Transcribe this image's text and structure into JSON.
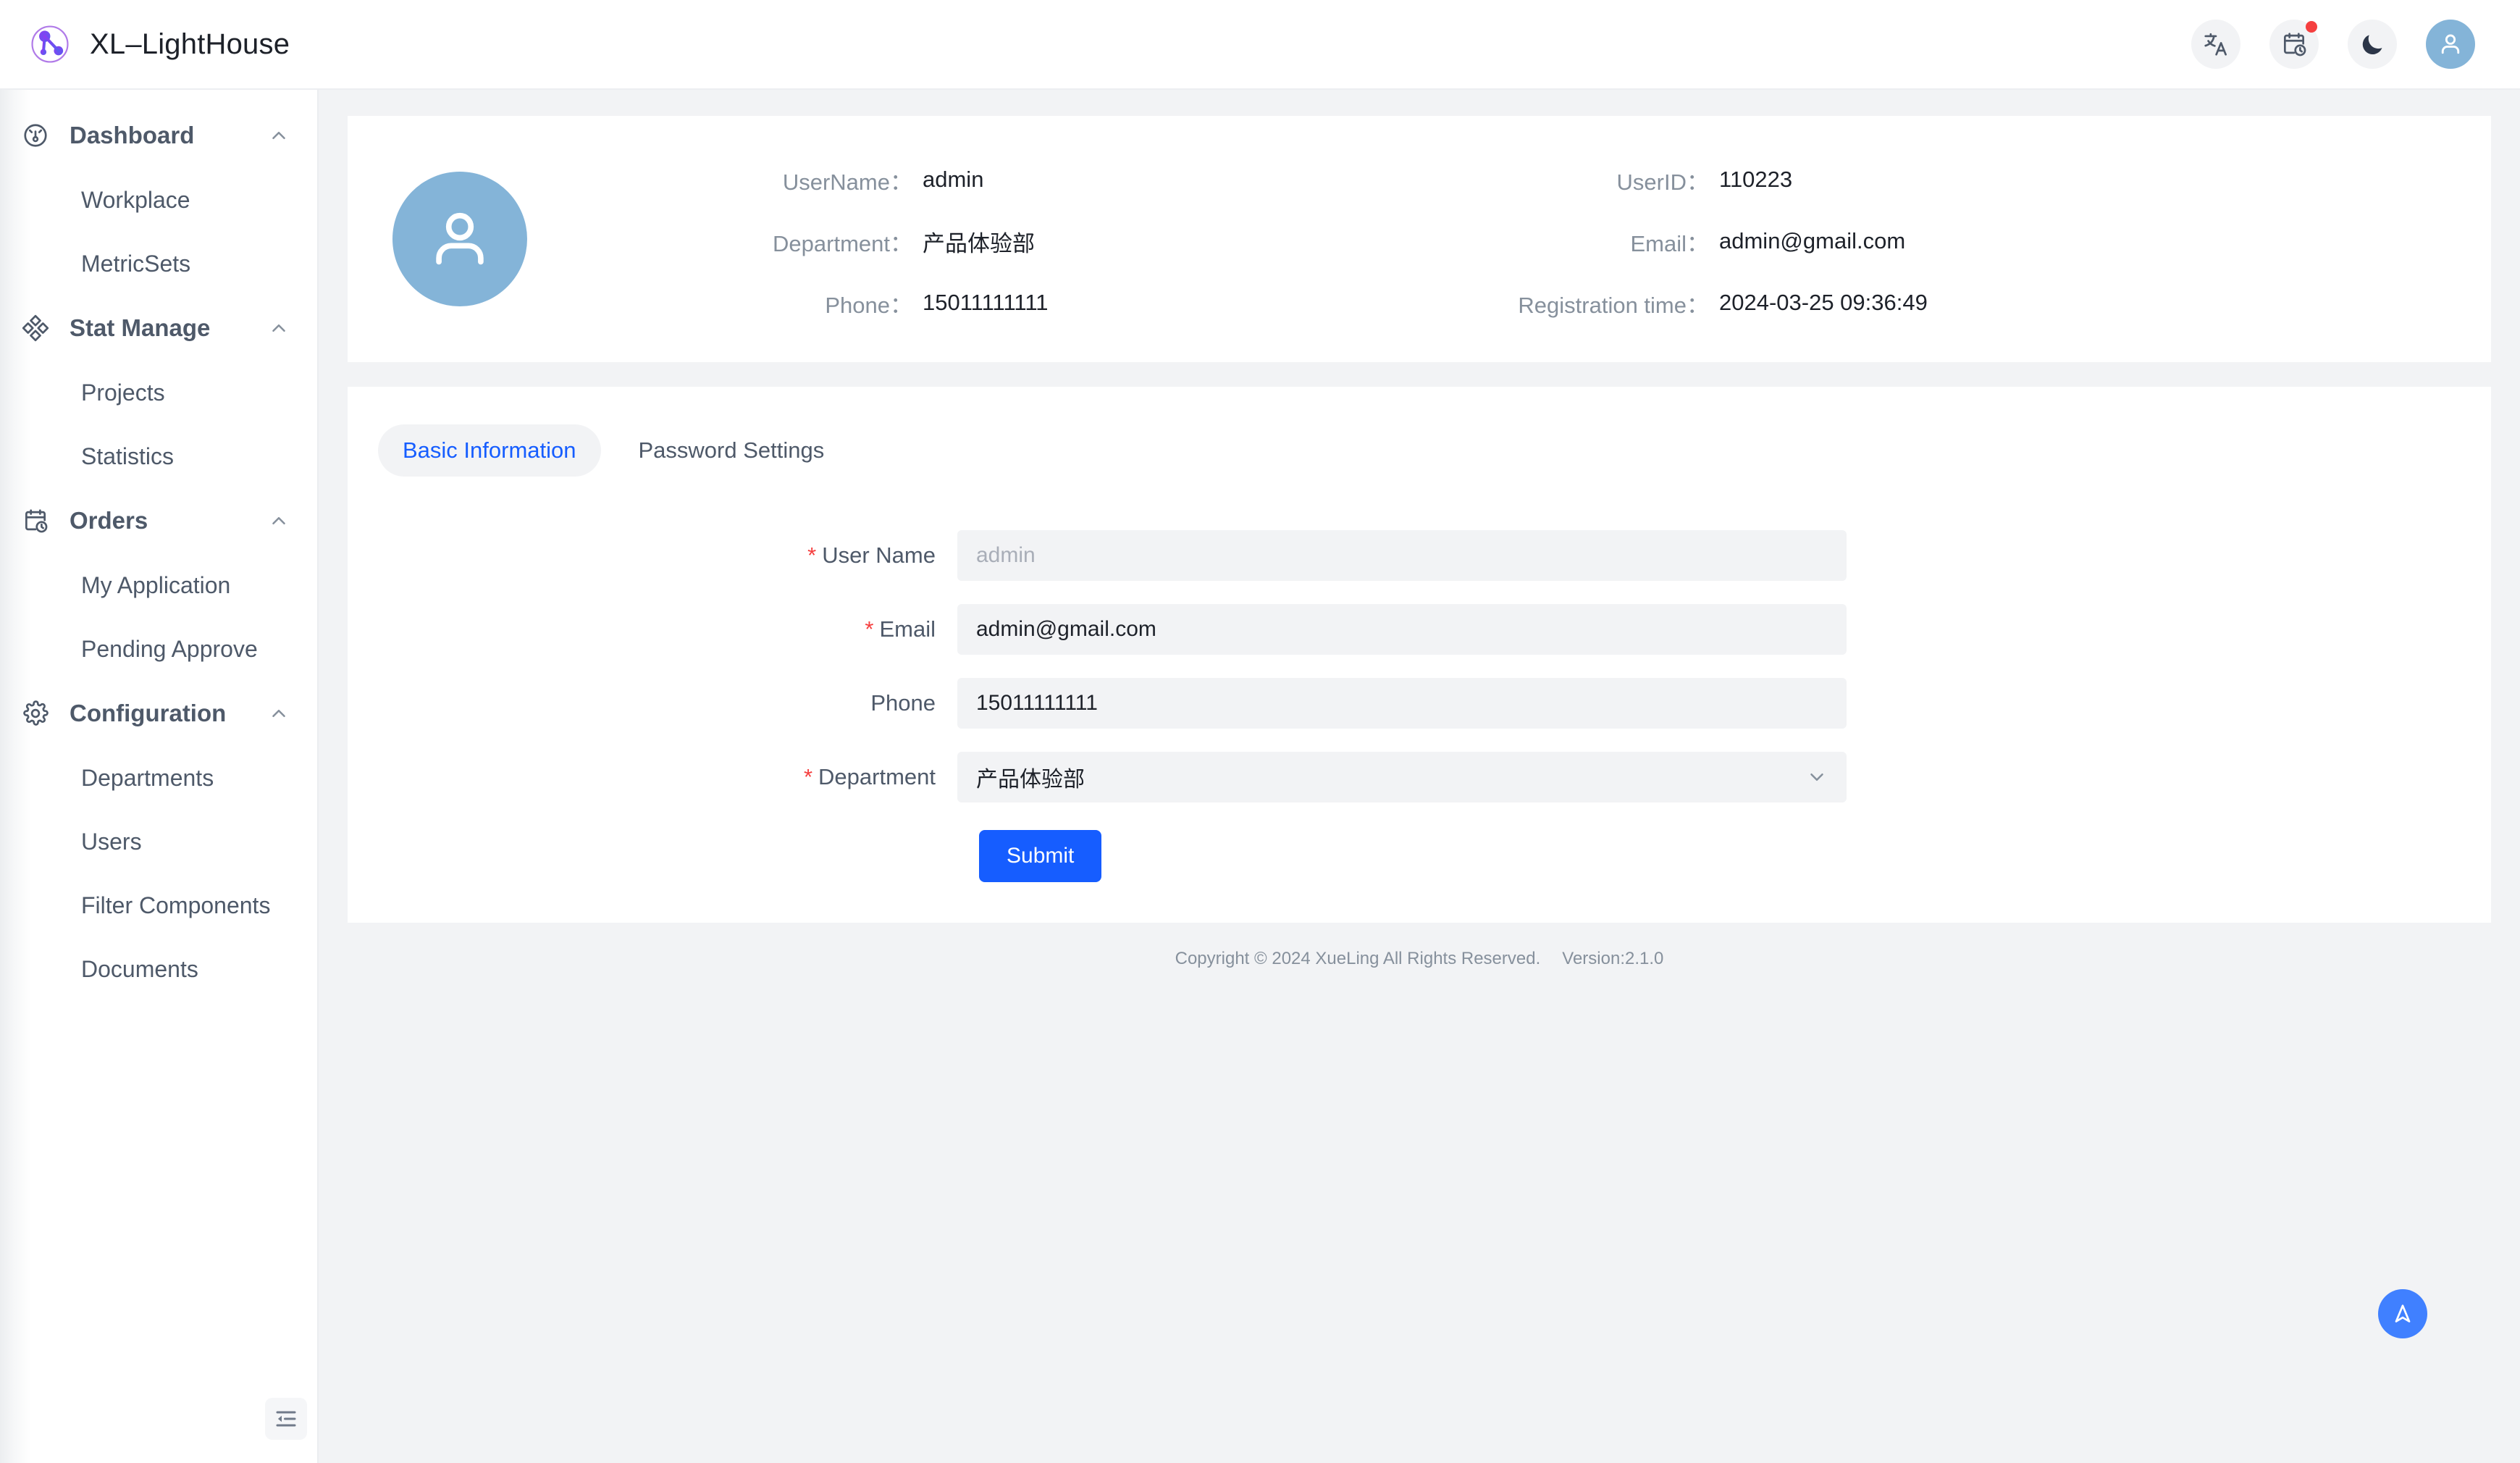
{
  "app": {
    "brand_name": "XL–LightHouse",
    "logo_icon": "molecule-logo-icon",
    "accent_color": "#165dff",
    "avatar_color": "#84b4d8",
    "badge_color": "#f53f3f"
  },
  "header": {
    "actions": [
      {
        "name": "translate",
        "icon": "translate-icon",
        "badge": false
      },
      {
        "name": "schedule",
        "icon": "calendar-clock-icon",
        "badge": true
      },
      {
        "name": "dark-mode",
        "icon": "moon-icon",
        "badge": false
      }
    ],
    "avatar_icon": "user-avatar-icon"
  },
  "sidebar": {
    "groups": [
      {
        "label": "Dashboard",
        "icon": "dashboard-gauge-icon",
        "chevron": "chevron-up-icon",
        "items": [
          {
            "label": "Workplace"
          },
          {
            "label": "MetricSets"
          }
        ]
      },
      {
        "label": "Stat Manage",
        "icon": "diamonds-icon",
        "chevron": "chevron-up-icon",
        "items": [
          {
            "label": "Projects"
          },
          {
            "label": "Statistics"
          }
        ]
      },
      {
        "label": "Orders",
        "icon": "calendar-clock-icon",
        "chevron": "chevron-up-icon",
        "items": [
          {
            "label": "My Application"
          },
          {
            "label": "Pending Approve"
          }
        ]
      },
      {
        "label": "Configuration",
        "icon": "gear-icon",
        "chevron": "chevron-up-icon",
        "items": [
          {
            "label": "Departments"
          },
          {
            "label": "Users"
          },
          {
            "label": "Filter Components"
          },
          {
            "label": "Documents"
          }
        ]
      }
    ],
    "collapse_icon": "collapse-sidebar-icon"
  },
  "profile": {
    "avatar_icon": "user-avatar-icon",
    "fields": [
      {
        "label": "UserName：",
        "value": "admin"
      },
      {
        "label": "UserID：",
        "value": "110223"
      },
      {
        "label": "Department：",
        "value": "产品体验部"
      },
      {
        "label": "Email：",
        "value": "admin@gmail.com"
      },
      {
        "label": "Phone：",
        "value": "15011111111"
      },
      {
        "label": "Registration time：",
        "value": "2024-03-25 09:36:49"
      }
    ]
  },
  "tabs": [
    {
      "label": "Basic Information",
      "active": true
    },
    {
      "label": "Password Settings",
      "active": false
    }
  ],
  "form": {
    "fields": [
      {
        "label": "User Name",
        "required": true,
        "value": "",
        "placeholder": "admin",
        "type": "text"
      },
      {
        "label": "Email",
        "required": true,
        "value": "admin@gmail.com",
        "placeholder": "",
        "type": "text"
      },
      {
        "label": "Phone",
        "required": false,
        "value": "15011111111",
        "placeholder": "",
        "type": "text"
      },
      {
        "label": "Department",
        "required": true,
        "value": "产品体验部",
        "placeholder": "",
        "type": "select",
        "chevron": "chevron-down-icon"
      }
    ],
    "submit_label": "Submit"
  },
  "footer": {
    "copyright": "Copyright © 2024 XueLing All Rights Reserved.",
    "version": "Version:2.1.0"
  },
  "back_to_top": {
    "icon": "navigation-arrow-up-icon"
  }
}
